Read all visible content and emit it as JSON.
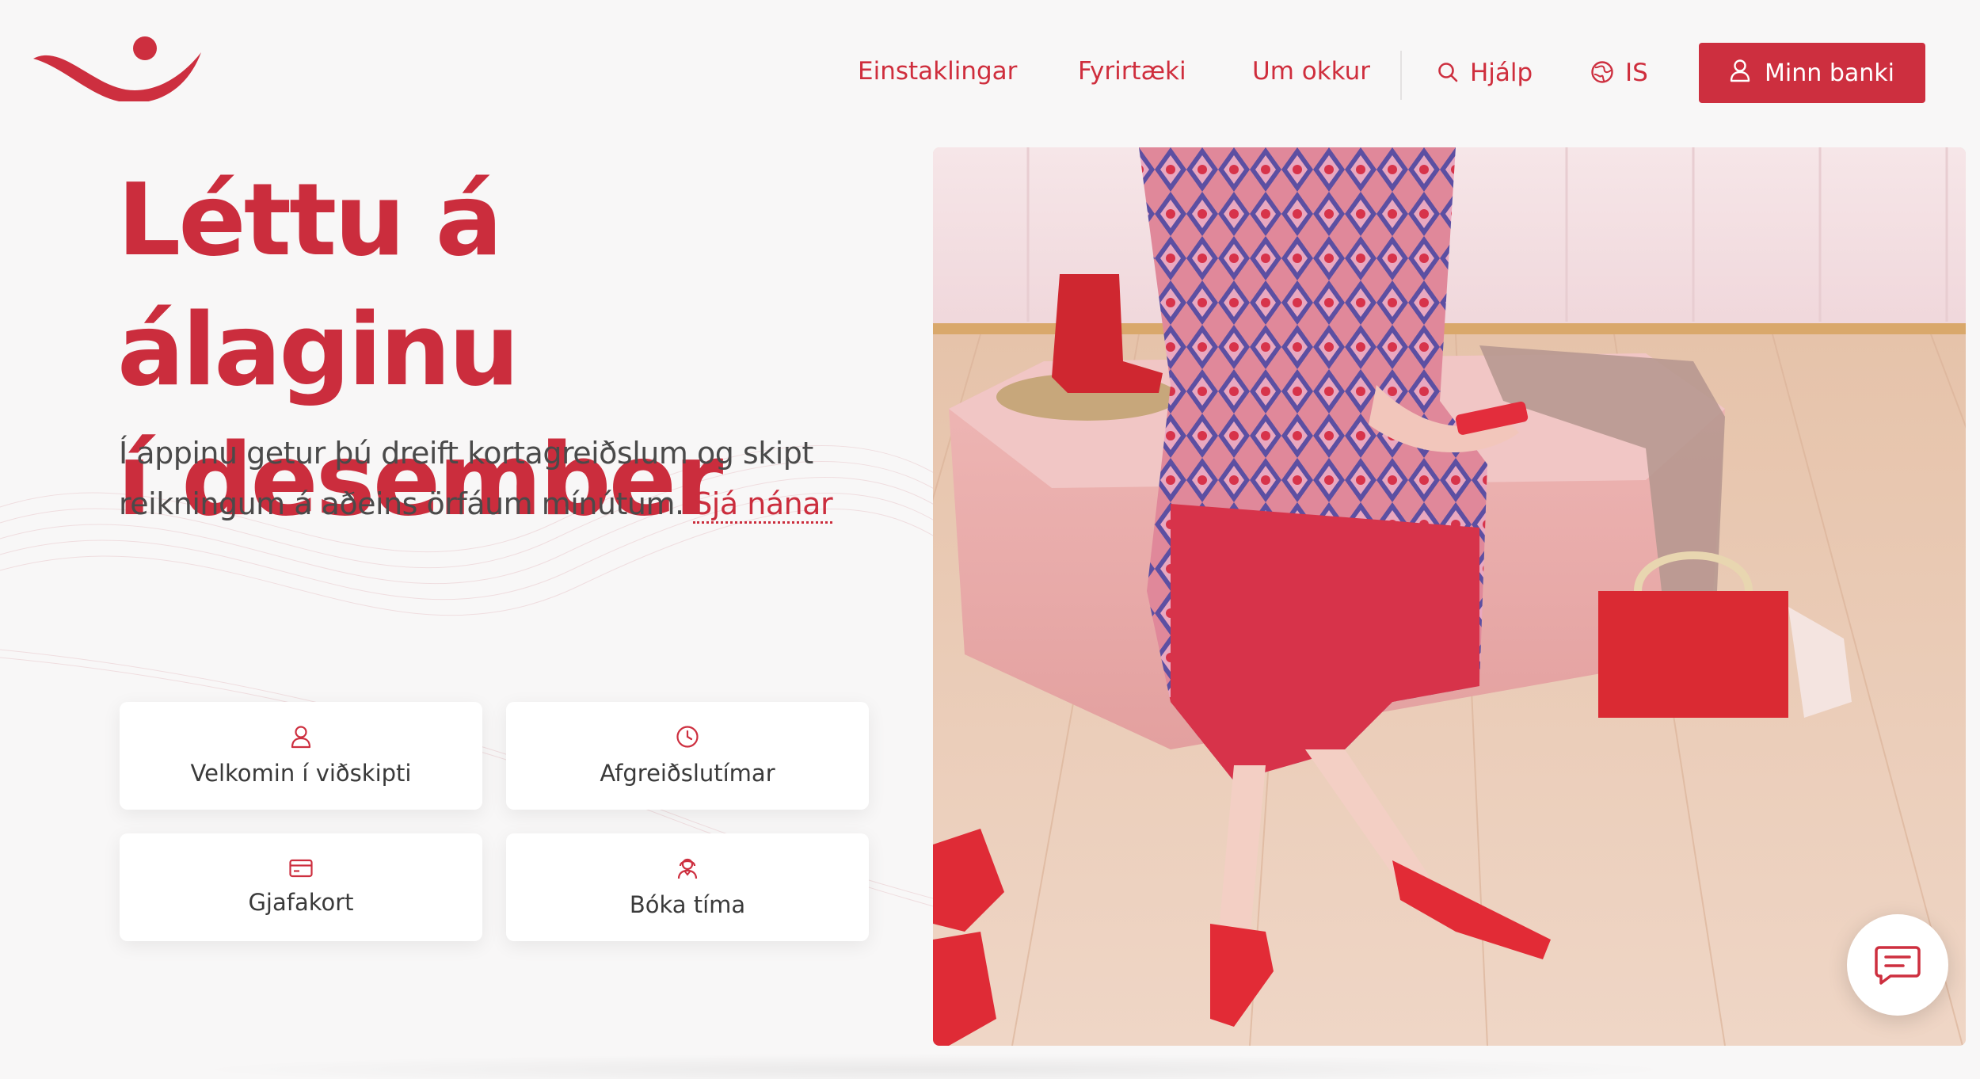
{
  "brand": {
    "logo_icon": "arion-smile-logo-icon",
    "accent_color": "#cd2f3f"
  },
  "nav": {
    "items": [
      {
        "label": "Einstaklingar"
      },
      {
        "label": "Fyrirtæki"
      },
      {
        "label": "Um okkur"
      }
    ],
    "help": {
      "label": "Hjálp",
      "icon": "search-icon"
    },
    "language": {
      "label": "IS",
      "icon": "globe-icon"
    },
    "login": {
      "label": "Minn banki",
      "icon": "user-icon"
    }
  },
  "hero": {
    "title_line1": "Léttu á álaginu",
    "title_line2": "í desember",
    "body": "Í appinu getur þú dreift kortagreiðslum og skipt reikningum á aðeins örfáum mínútum.",
    "link": "Sjá nánar"
  },
  "quick_links": [
    {
      "label": "Velkomin í viðskipti",
      "icon": "user-icon"
    },
    {
      "label": "Afgreiðslutímar",
      "icon": "clock-icon"
    },
    {
      "label": "Gjafakort",
      "icon": "credit-card-icon"
    },
    {
      "label": "Bóka tíma",
      "icon": "person-headset-icon"
    }
  ],
  "chat": {
    "icon": "chat-icon"
  }
}
